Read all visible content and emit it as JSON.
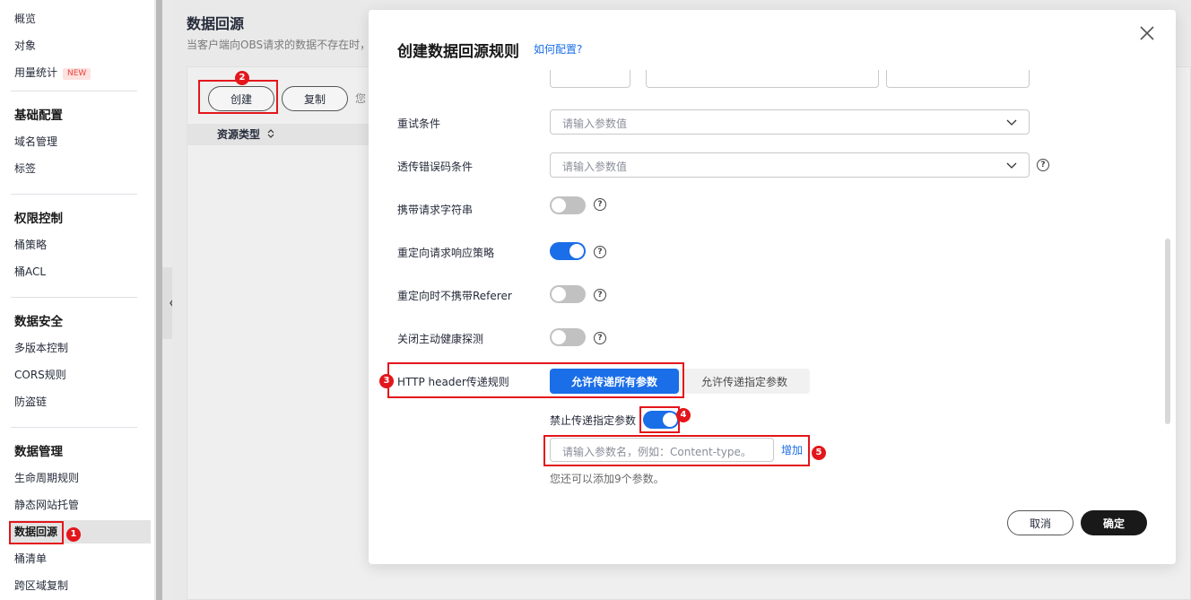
{
  "sidebar": {
    "items_top": [
      {
        "label": "概览"
      },
      {
        "label": "对象"
      },
      {
        "label": "用量统计",
        "badge": "NEW"
      }
    ],
    "sections": [
      {
        "heading": "基础配置",
        "items": [
          "域名管理",
          "标签"
        ]
      },
      {
        "heading": "权限控制",
        "items": [
          "桶策略",
          "桶ACL"
        ]
      },
      {
        "heading": "数据安全",
        "items": [
          "多版本控制",
          "CORS规则",
          "防盗链"
        ]
      },
      {
        "heading": "数据管理",
        "items": [
          "生命周期规则",
          "静态网站托管",
          "数据回源",
          "桶清单",
          "跨区域复制"
        ]
      }
    ],
    "active_item": "数据回源"
  },
  "page": {
    "title": "数据回源",
    "description": "当客户端向OBS请求的数据不存在时，",
    "create_button": "创建",
    "copy_button": "复制",
    "trailing_hint": "您",
    "table_column": "资源类型"
  },
  "modal": {
    "title": "创建数据回源规则",
    "help_link": "如何配置?",
    "fields": {
      "retry_condition": {
        "label": "重试条件",
        "placeholder": "请输入参数值"
      },
      "passthrough_error": {
        "label": "透传错误码条件",
        "placeholder": "请输入参数值"
      },
      "carry_query": {
        "label": "携带请求字符串",
        "enabled": false
      },
      "redirect_policy": {
        "label": "重定向请求响应策略",
        "enabled": true
      },
      "redirect_no_referer": {
        "label": "重定向时不携带Referer",
        "enabled": false
      },
      "close_health_check": {
        "label": "关闭主动健康探测",
        "enabled": false
      },
      "http_header_rule": {
        "label": "HTTP header传递规则",
        "options": [
          "允许传递所有参数",
          "允许传递指定参数"
        ],
        "selected": "允许传递所有参数"
      },
      "forbid_params": {
        "label": "禁止传递指定参数",
        "enabled": true,
        "input_placeholder": "请输入参数名，例如：Content-type。",
        "add_label": "增加",
        "hint": "您还可以添加9个参数。"
      }
    },
    "cancel_label": "取消",
    "confirm_label": "确定"
  },
  "annotations": [
    "1",
    "2",
    "3",
    "4",
    "5"
  ],
  "colors": {
    "accent": "#1a6ee8",
    "callout": "#e3161b",
    "primary_button": "#191919"
  }
}
